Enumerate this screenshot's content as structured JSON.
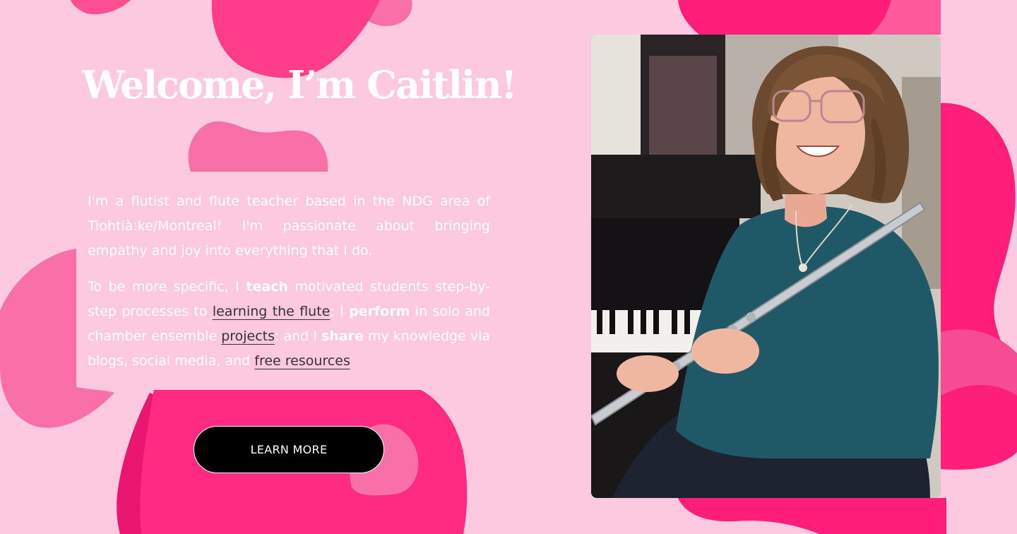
{
  "hero": {
    "heading": "Welcome, I’m Caitlin!",
    "intro": {
      "p1": "I'm a flutist and flute teacher based in the NDG area of Tiohtià:ke/Montreal! I'm passionate about bringing empathy and joy into everything that I do.",
      "p2_a": "To be more specific, I ",
      "teach": "teach",
      "p2_b": " motivated students step-by-step processes to ",
      "link_learning": "learning the flute",
      "p2_c": "; I ",
      "perform": "perform",
      "p2_d": " in solo and chamber ensemble ",
      "link_projects": "projects",
      "p2_e": "; and I ",
      "share": "share",
      "p2_f": " my knowledge via blogs, social media, and ",
      "link_resources": "free resources"
    },
    "cta_label": "LEARN MORE"
  },
  "colors": {
    "background": "#fdc9e1",
    "blob_hot": "#ff1f7a",
    "blob_mid": "#fe5a9b",
    "blob_soft": "#f96fa8",
    "button_bg": "#000000",
    "text": "#ffffff",
    "link": "#333333"
  }
}
